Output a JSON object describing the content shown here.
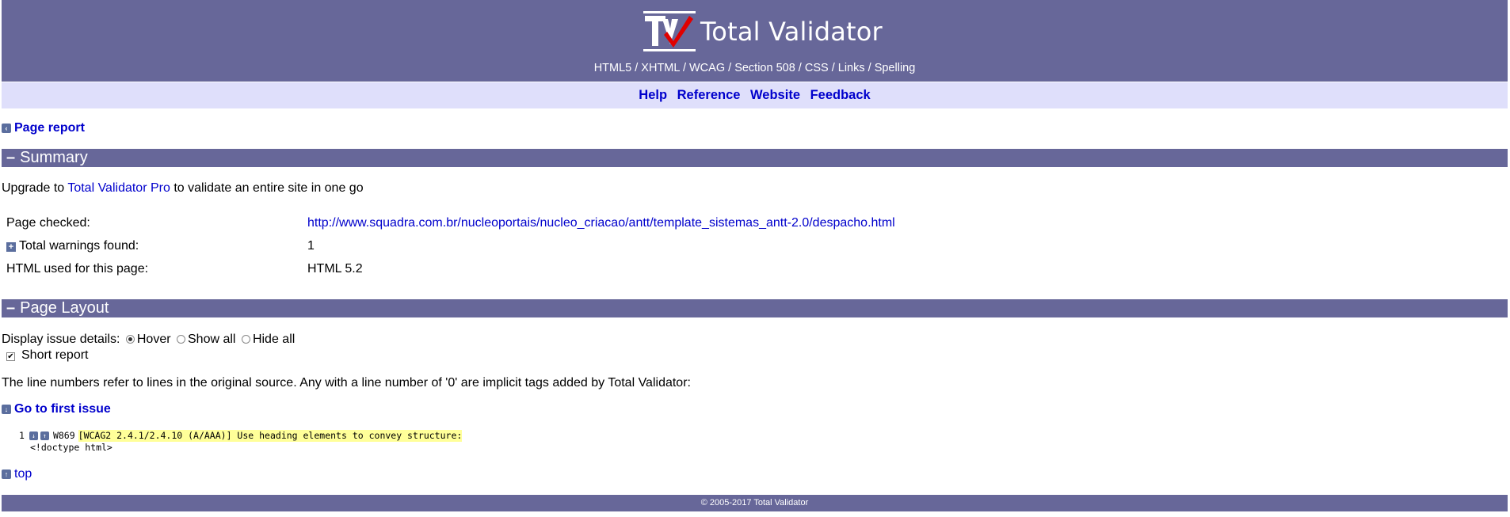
{
  "header": {
    "title": "Total Validator",
    "tagline": "HTML5 / XHTML / WCAG / Section 508 / CSS / Links / Spelling",
    "logo_icon": "tv-checkmark-logo",
    "nav": [
      "Help",
      "Reference",
      "Website",
      "Feedback"
    ]
  },
  "back_link": "Page report",
  "summary": {
    "heading": "Summary",
    "upgrade_prefix": "Upgrade to ",
    "upgrade_link": "Total Validator Pro",
    "upgrade_suffix": " to validate an entire site in one go",
    "rows": [
      {
        "label": "Page checked:",
        "value": "http://www.squadra.com.br/nucleoportais/nucleo_criacao/antt/template_sistemas_antt-2.0/despacho.html"
      },
      {
        "label": "Total warnings found:",
        "value": "1"
      },
      {
        "label": "HTML used for this page:",
        "value": "HTML 5.2"
      }
    ]
  },
  "layout": {
    "heading": "Page Layout",
    "display_label": "Display issue details:",
    "options": [
      "Hover",
      "Show all",
      "Hide all"
    ],
    "selected_option": "Hover",
    "short_report_label": "Short report",
    "short_report_checked": true,
    "note": "The line numbers refer to lines in the original source. Any with a line number of '0' are implicit tags added by Total Validator:",
    "goto_first": "Go to first issue",
    "issue": {
      "line": "1",
      "code": "W869",
      "message": "[WCAG2 2.4.1/2.4.10 (A/AAA)] Use heading elements to convey structure:",
      "source": "<!doctype html>"
    },
    "top_link": "top"
  },
  "footer": "© 2005-2017 Total Validator",
  "colors": {
    "header_bg": "#676799",
    "nav_bg": "#dfdffb",
    "link": "#0000cc",
    "highlight": "#ffff99"
  }
}
